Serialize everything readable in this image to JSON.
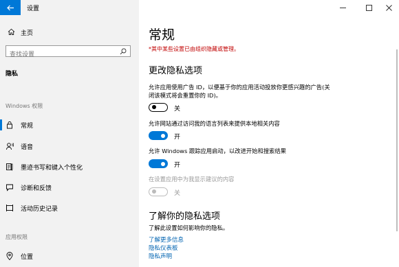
{
  "window": {
    "title": "设置"
  },
  "sidebar": {
    "home_label": "主页",
    "search_placeholder": "查找设置",
    "section_title": "隐私",
    "group_windows": "Windows 权限",
    "group_app": "应用权限",
    "items": [
      {
        "label": "常规",
        "icon": "lock-icon",
        "active": true
      },
      {
        "label": "语音",
        "icon": "speech-icon",
        "active": false
      },
      {
        "label": "墨迹书写和键入个性化",
        "icon": "pen-keyboard-icon",
        "active": false
      },
      {
        "label": "诊断和反馈",
        "icon": "feedback-icon",
        "active": false
      },
      {
        "label": "活动历史记录",
        "icon": "activity-history-icon",
        "active": false
      },
      {
        "label": "位置",
        "icon": "location-icon",
        "active": false
      }
    ]
  },
  "main": {
    "title": "常规",
    "warning": "*其中某些设置已由组织隐藏或管理。",
    "section_heading": "更改隐私选项",
    "options": [
      {
        "desc_line1": "允许应用使用广告 ID，以便基于你的应用活动投放你更感兴趣的广告(关",
        "desc_line2": "闭该模式将会重置你的 ID)。",
        "state": "关",
        "on": false,
        "disabled": false
      },
      {
        "desc_line1": "允许网站通过访问我的语言列表来提供本地相关内容",
        "desc_line2": "",
        "state": "开",
        "on": true,
        "disabled": false
      },
      {
        "desc_line1": "允许 Windows 跟踪应用启动，以改进开始和搜索结果",
        "desc_line2": "",
        "state": "开",
        "on": true,
        "disabled": false
      },
      {
        "desc_line1": "在设置应用中为我显示建议的内容",
        "desc_line2": "",
        "state": "关",
        "on": false,
        "disabled": true
      }
    ],
    "learn_heading": "了解你的隐私选项",
    "learn_desc": "了解此设置如何影响你的隐私。",
    "links": [
      "了解更多信息",
      "隐私仪表板",
      "隐私声明"
    ]
  },
  "colors": {
    "accent": "#0078d7",
    "warning": "#c00000",
    "link": "#0063b1"
  }
}
